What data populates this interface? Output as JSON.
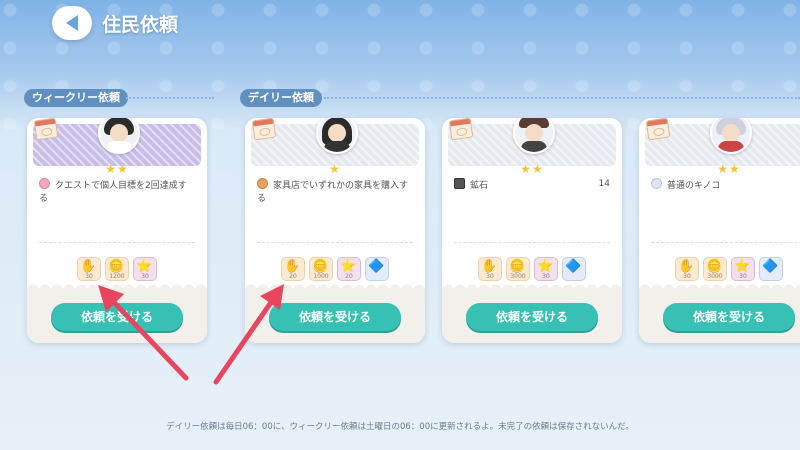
{
  "header": {
    "title": "住民依頼",
    "back_icon": "back-arrow-icon"
  },
  "sections": {
    "weekly_label": "ウィークリー依頼",
    "daily_label": "デイリー依頼"
  },
  "cards": [
    {
      "type": "weekly",
      "stars": "★★",
      "task_text": "クエストで個人目標を2回達成する",
      "task_count": "",
      "rewards": [
        {
          "icon": "hand-icon",
          "qty": "30"
        },
        {
          "icon": "coin-icon",
          "qty": "1200"
        },
        {
          "icon": "star-icon",
          "qty": "30"
        }
      ],
      "button": "依頼を受ける"
    },
    {
      "type": "daily",
      "stars": "★",
      "task_text": "家具店でいずれかの家具を購入する",
      "task_count": "",
      "rewards": [
        {
          "icon": "hand-icon",
          "qty": "20"
        },
        {
          "icon": "coin-icon",
          "qty": "1000"
        },
        {
          "icon": "star-icon",
          "qty": "20"
        },
        {
          "icon": "badge-icon",
          "qty": ""
        }
      ],
      "button": "依頼を受ける"
    },
    {
      "type": "daily",
      "stars": "★★",
      "task_text": "鉱石",
      "task_count": "14",
      "rewards": [
        {
          "icon": "hand-icon",
          "qty": "30"
        },
        {
          "icon": "coin-icon",
          "qty": "3000"
        },
        {
          "icon": "star-icon",
          "qty": "30"
        },
        {
          "icon": "badge-icon",
          "qty": ""
        }
      ],
      "button": "依頼を受ける"
    },
    {
      "type": "daily",
      "stars": "★★",
      "task_text": "普通のキノコ",
      "task_count": "",
      "rewards": [
        {
          "icon": "hand-icon",
          "qty": "30"
        },
        {
          "icon": "coin-icon",
          "qty": "3000"
        },
        {
          "icon": "star-icon",
          "qty": "30"
        },
        {
          "icon": "badge-icon",
          "qty": ""
        }
      ],
      "button": "依頼を受ける"
    }
  ],
  "footer": "デイリー依頼は毎日06：00に、ウィークリー依頼は土曜日の06：00に更新されるよ。未完了の依頼は保存されないんだ。",
  "colors": {
    "accent": "#36c1b4",
    "section_tag": "#5f90bf",
    "annotation_arrow": "#e8455e"
  }
}
